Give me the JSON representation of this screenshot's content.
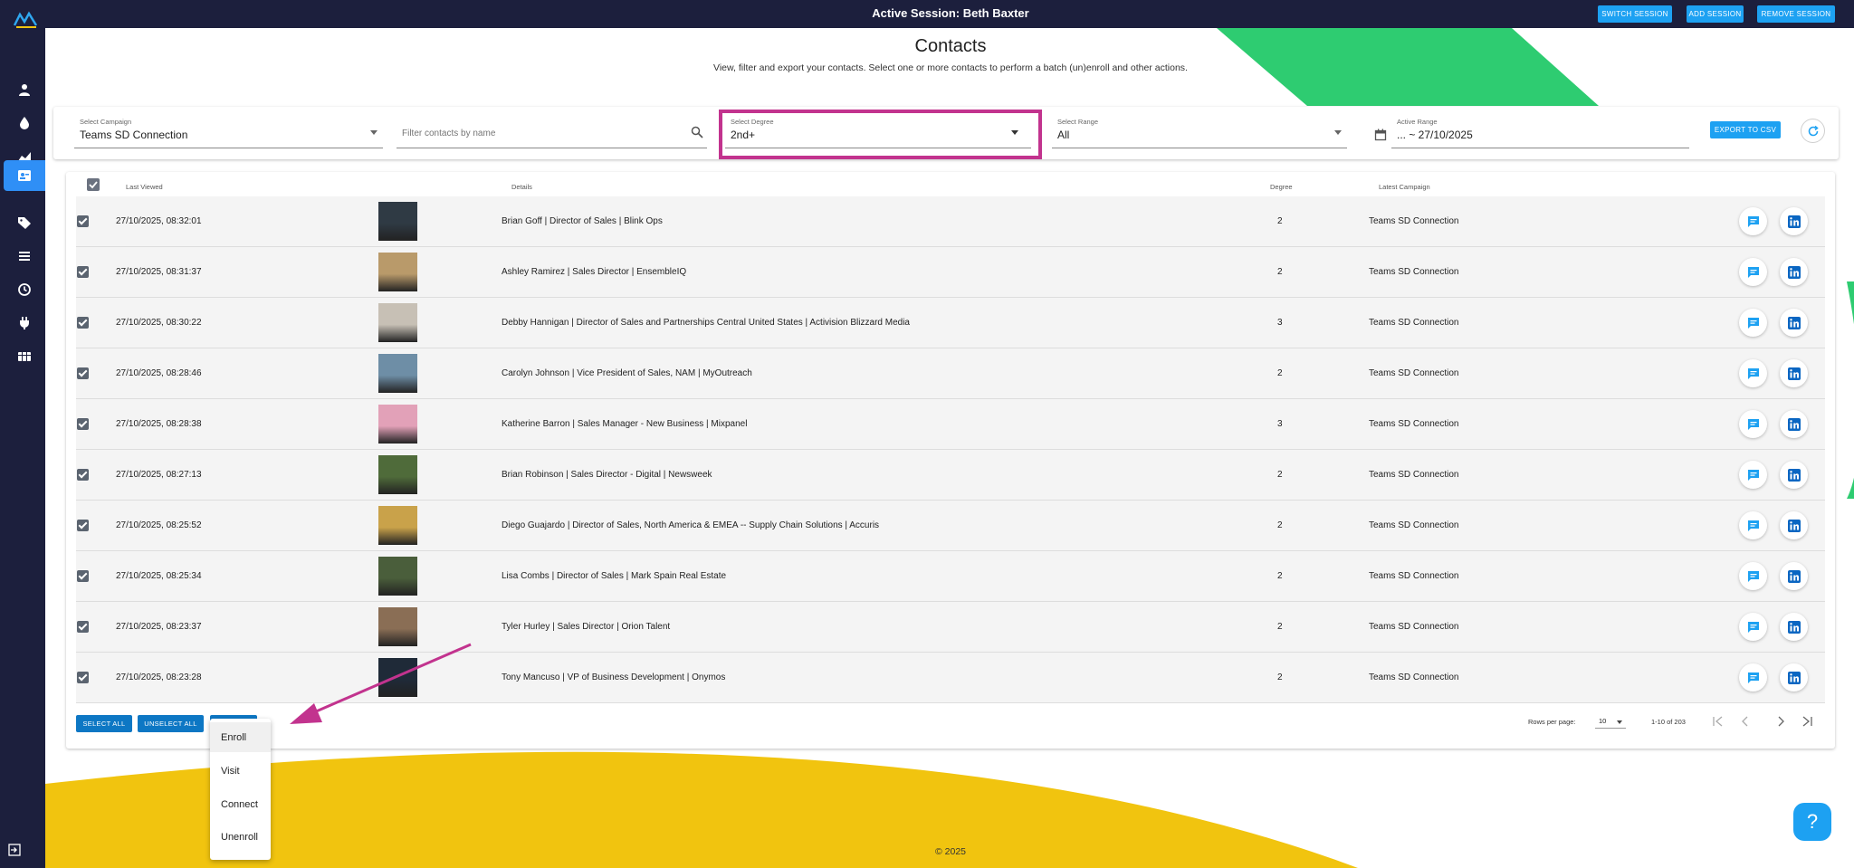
{
  "topbar": {
    "title": "Active Session: Beth Baxter",
    "buttons": [
      "SWITCH SESSION",
      "ADD SESSION",
      "REMOVE SESSION"
    ]
  },
  "sidebar": {
    "icons": [
      "person-icon",
      "drop-icon",
      "chart-icon",
      "contacts-icon",
      "tag-icon",
      "list-icon",
      "history-icon",
      "plug-icon",
      "table-icon"
    ],
    "active_index": 3
  },
  "header": {
    "title": "Contacts",
    "subtitle": "View, filter and export your contacts. Select one or more contacts to perform a batch (un)enroll and other actions."
  },
  "filters": {
    "campaign_label": "Select Campaign",
    "campaign_value": "Teams SD Connection",
    "search_placeholder": "Filter contacts by name",
    "degree_label": "Select Degree",
    "degree_value": "2nd+",
    "range_label": "Select Range",
    "range_value": "All",
    "active_range_label": "Active Range",
    "active_range_value": "... ~ 27/10/2025",
    "export_label": "EXPORT TO CSV"
  },
  "table": {
    "headers": {
      "last_viewed": "Last Viewed",
      "details": "Details",
      "degree": "Degree",
      "latest_campaign": "Latest Campaign"
    },
    "rows": [
      {
        "time": "27/10/2025, 08:32:01",
        "details": "Brian Goff | Director of Sales  | Blink Ops",
        "degree": "2",
        "campaign": "Teams SD Connection",
        "avatar_color": "#2f3a44"
      },
      {
        "time": "27/10/2025, 08:31:37",
        "details": "Ashley Ramirez | Sales Director  | EnsembleIQ",
        "degree": "2",
        "campaign": "Teams SD Connection",
        "avatar_color": "#b99a6a"
      },
      {
        "time": "27/10/2025, 08:30:22",
        "details": "Debby Hannigan | Director of Sales and Partnerships Central United States  | Activision Blizzard Media",
        "degree": "3",
        "campaign": "Teams SD Connection",
        "avatar_color": "#c7c0b5"
      },
      {
        "time": "27/10/2025, 08:28:46",
        "details": "Carolyn Johnson | Vice President of Sales, NAM  | MyOutreach",
        "degree": "2",
        "campaign": "Teams SD Connection",
        "avatar_color": "#6e8ea6"
      },
      {
        "time": "27/10/2025, 08:28:38",
        "details": "Katherine Barron | Sales Manager - New Business  | Mixpanel",
        "degree": "3",
        "campaign": "Teams SD Connection",
        "avatar_color": "#e2a1b8"
      },
      {
        "time": "27/10/2025, 08:27:13",
        "details": "Brian Robinson | Sales Director - Digital  | Newsweek",
        "degree": "2",
        "campaign": "Teams SD Connection",
        "avatar_color": "#4f6b3a"
      },
      {
        "time": "27/10/2025, 08:25:52",
        "details": "Diego Guajardo | Director of Sales, North America & EMEA -- Supply Chain Solutions  | Accuris",
        "degree": "2",
        "campaign": "Teams SD Connection",
        "avatar_color": "#c9a24a"
      },
      {
        "time": "27/10/2025, 08:25:34",
        "details": "Lisa Combs | Director of Sales  | Mark Spain Real Estate",
        "degree": "2",
        "campaign": "Teams SD Connection",
        "avatar_color": "#4a5e3b"
      },
      {
        "time": "27/10/2025, 08:23:37",
        "details": "Tyler Hurley | Sales Director  | Orion Talent",
        "degree": "2",
        "campaign": "Teams SD Connection",
        "avatar_color": "#8a6e55"
      },
      {
        "time": "27/10/2025, 08:23:28",
        "details": "Tony Mancuso | VP of Business Development  | Onymos",
        "degree": "2",
        "campaign": "Teams SD Connection",
        "avatar_color": "#1f2a38"
      }
    ]
  },
  "actions": {
    "select_all": "SELECT ALL",
    "unselect_all": "UNSELECT ALL"
  },
  "menu": {
    "items": [
      "Enroll",
      "Visit",
      "Connect",
      "Unenroll"
    ]
  },
  "pagination": {
    "rows_per_page_label": "Rows per page:",
    "rows_per_page_value": "10",
    "range_text": "1-10 of 203"
  },
  "footer": {
    "copyright": "© 2025"
  },
  "help_label": "?",
  "colors": {
    "nav_bg": "#1c1f3d",
    "accent_blue": "#1da1f2",
    "highlight_magenta": "#c2338e",
    "green_shape": "#2ecc71",
    "yellow_shape": "#f1c40f"
  }
}
